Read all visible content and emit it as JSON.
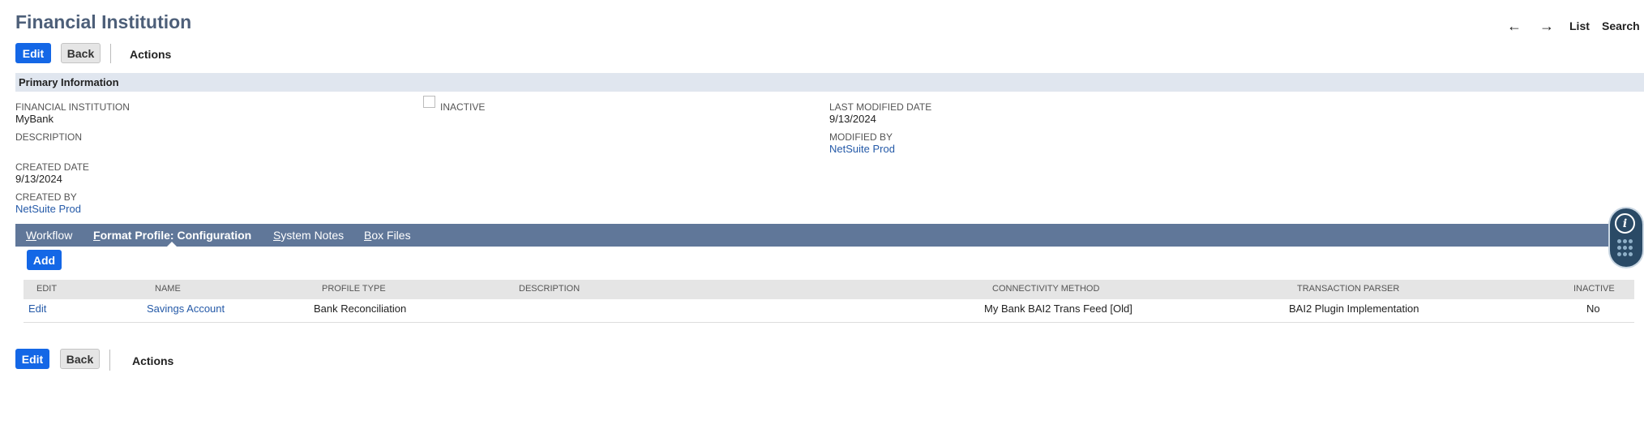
{
  "header": {
    "title": "Financial Institution",
    "nav": {
      "back_arrow": "←",
      "forward_arrow": "→",
      "list": "List",
      "search": "Search"
    }
  },
  "toolbar_top": {
    "edit": "Edit",
    "back": "Back",
    "actions": "Actions"
  },
  "toolbar_bottom": {
    "edit": "Edit",
    "back": "Back",
    "actions": "Actions"
  },
  "primary_info": {
    "section_title": "Primary Information",
    "fields": {
      "financial_institution": {
        "label": "FINANCIAL INSTITUTION",
        "value": "MyBank"
      },
      "inactive": {
        "label": "INACTIVE",
        "checked": false
      },
      "description": {
        "label": "DESCRIPTION",
        "value": ""
      },
      "created_date": {
        "label": "CREATED DATE",
        "value": "9/13/2024"
      },
      "created_by": {
        "label": "CREATED BY",
        "value": "NetSuite Prod"
      },
      "last_modified_date": {
        "label": "LAST MODIFIED DATE",
        "value": "9/13/2024"
      },
      "modified_by": {
        "label": "MODIFIED BY",
        "value": "NetSuite Prod"
      }
    }
  },
  "tabs": [
    {
      "label_first": "W",
      "label_rest": "orkflow",
      "active": false
    },
    {
      "label_first": "F",
      "label_rest": "ormat Profile: Configuration",
      "active": true
    },
    {
      "label_first": "S",
      "label_rest": "ystem Notes",
      "active": false
    },
    {
      "label_first": "B",
      "label_rest": "ox Files",
      "active": false
    }
  ],
  "sublist": {
    "add_button": "Add",
    "columns": [
      "EDIT",
      "NAME",
      "PROFILE TYPE",
      "DESCRIPTION",
      "CONNECTIVITY METHOD",
      "TRANSACTION PARSER",
      "INACTIVE"
    ],
    "rows": [
      {
        "edit": "Edit",
        "name": "Savings Account",
        "profile_type": "Bank Reconciliation",
        "description": "",
        "connectivity_method": "My Bank BAI2 Trans Feed [Old]",
        "transaction_parser": "BAI2 Plugin Implementation",
        "inactive": "No"
      }
    ]
  },
  "widget": {
    "info_icon": "info-icon",
    "grid_icon": "dots-grid-icon",
    "info_glyph": "i"
  },
  "colors": {
    "title": "#4d5f79",
    "primary_button": "#1467e6",
    "section_bar": "#e0e6ef",
    "tab_bar": "#607799",
    "link": "#255aa8",
    "widget": "#2a4a66"
  }
}
